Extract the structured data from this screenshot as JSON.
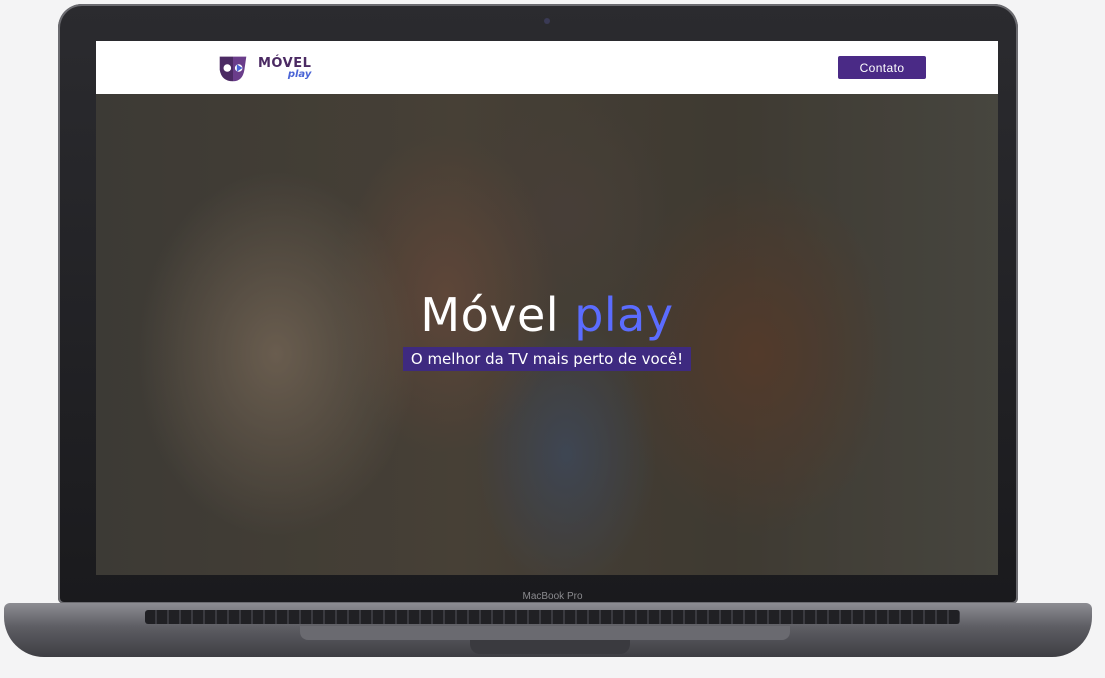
{
  "logo": {
    "word1": "MÓVEL",
    "word2": "play"
  },
  "header": {
    "contact_label": "Contato"
  },
  "hero": {
    "title_main": "Móvel",
    "title_accent": "play",
    "tagline": "O melhor da TV mais perto de você!"
  },
  "device": {
    "label": "MacBook Pro"
  },
  "colors": {
    "brand_purple": "#4a2a86",
    "accent_blue": "#5b6cff",
    "logo_purple": "#4b2a63"
  }
}
